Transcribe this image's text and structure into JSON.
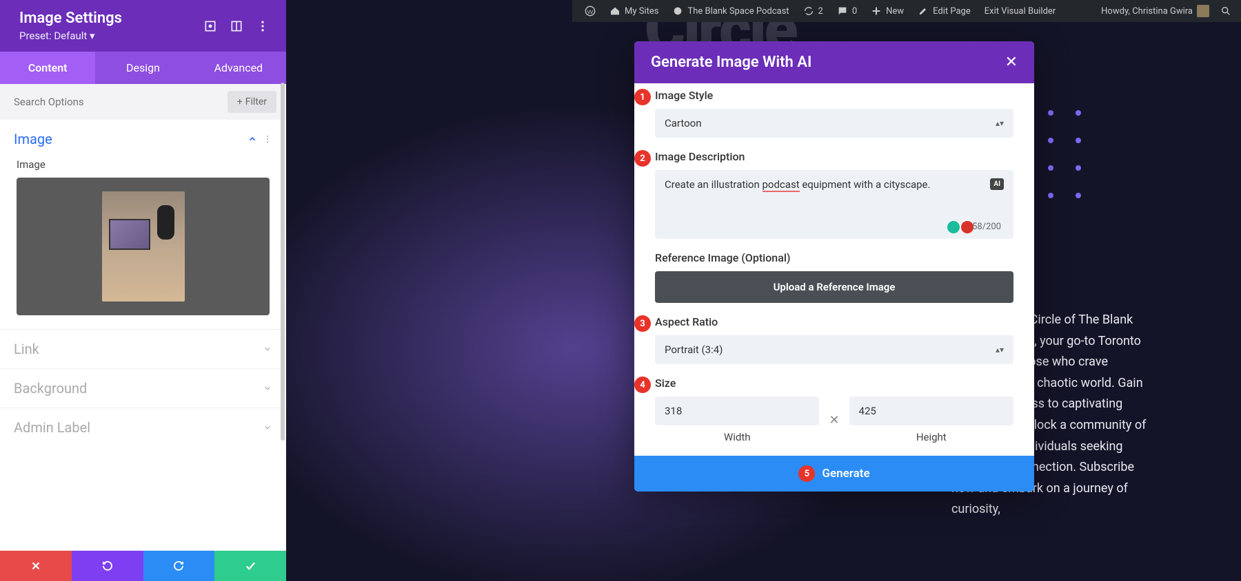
{
  "admin_bar": {
    "my_sites": "My Sites",
    "site_name": "The Blank Space Podcast",
    "updates": "2",
    "comments": "0",
    "new": "New",
    "edit": "Edit Page",
    "exit": "Exit Visual Builder",
    "howdy": "Howdy, Christina Gwira"
  },
  "sidebar": {
    "title": "Image Settings",
    "preset": "Preset: Default ▾",
    "tabs": {
      "content": "Content",
      "design": "Design",
      "advanced": "Advanced"
    },
    "search_placeholder": "Search Options",
    "filter": "Filter",
    "sections": {
      "image": "Image",
      "image_label": "Image",
      "link": "Link",
      "background": "Background",
      "admin_label": "Admin Label"
    }
  },
  "modal": {
    "title": "Generate Image With AI",
    "style_label": "Image Style",
    "style_value": "Cartoon",
    "desc_label": "Image Description",
    "desc_pre": "Create an illustration ",
    "desc_mid": "podcast",
    "desc_post": " equipment with a cityscape.",
    "ai_badge": "AI",
    "counter": "58/200",
    "ref_label": "Reference Image (Optional)",
    "upload": "Upload a Reference Image",
    "aspect_label": "Aspect Ratio",
    "aspect_value": "Portrait (3:4)",
    "size_label": "Size",
    "width": "318",
    "height": "425",
    "width_label": "Width",
    "height_label": "Height",
    "generate": "Generate",
    "nums": {
      "n1": "1",
      "n2": "2",
      "n3": "3",
      "n4": "4",
      "n5": "5"
    }
  },
  "page": {
    "body_text": "Join the Inner Circle of The Blank Space Podcast, your go-to Toronto podcast for those who crave knowledge in a chaotic world. Gain exclusive access to captivating content and unlock a community of like-minded individuals seeking clarity and connection. Subscribe now and embark on a journey of curiosity,",
    "bg_title": "Circle"
  }
}
